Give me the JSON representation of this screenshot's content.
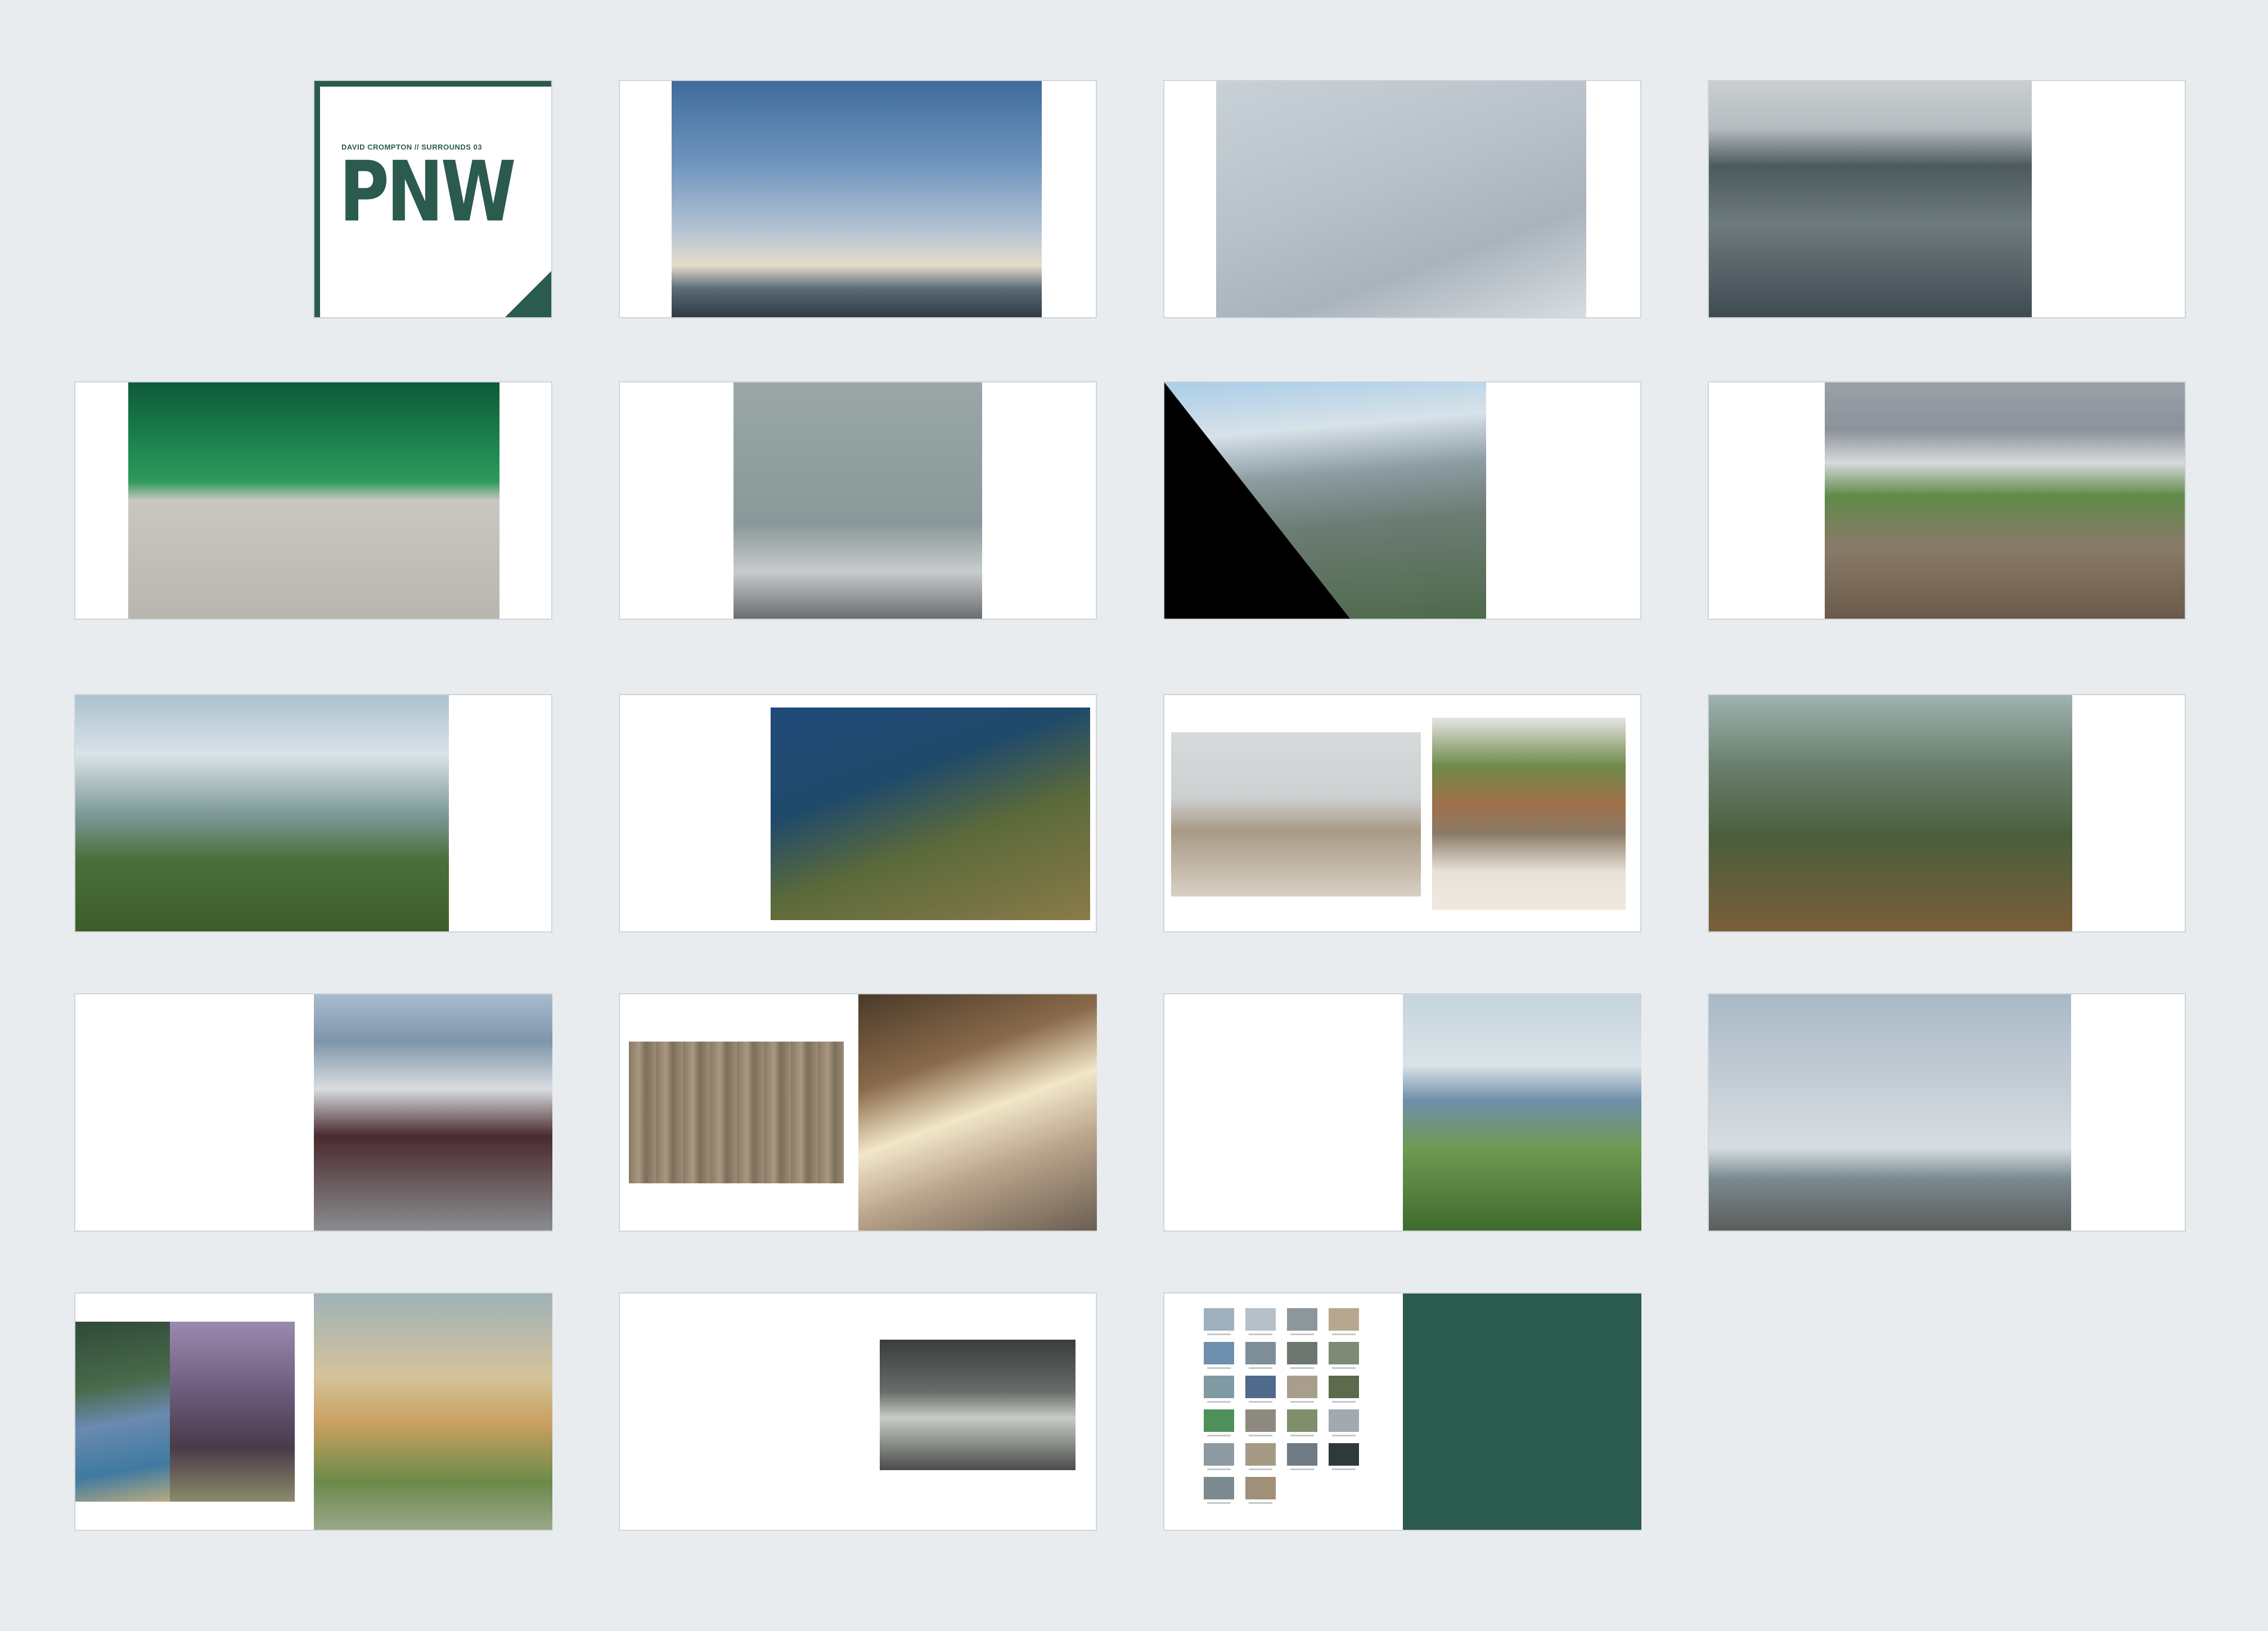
{
  "cover": {
    "subtitle": "DAVID CROMPTON // SURROUNDS 03",
    "title": "PNW"
  },
  "colors": {
    "accent": "#2b5a4e",
    "background": "#e9ecee",
    "page": "#ffffff"
  }
}
